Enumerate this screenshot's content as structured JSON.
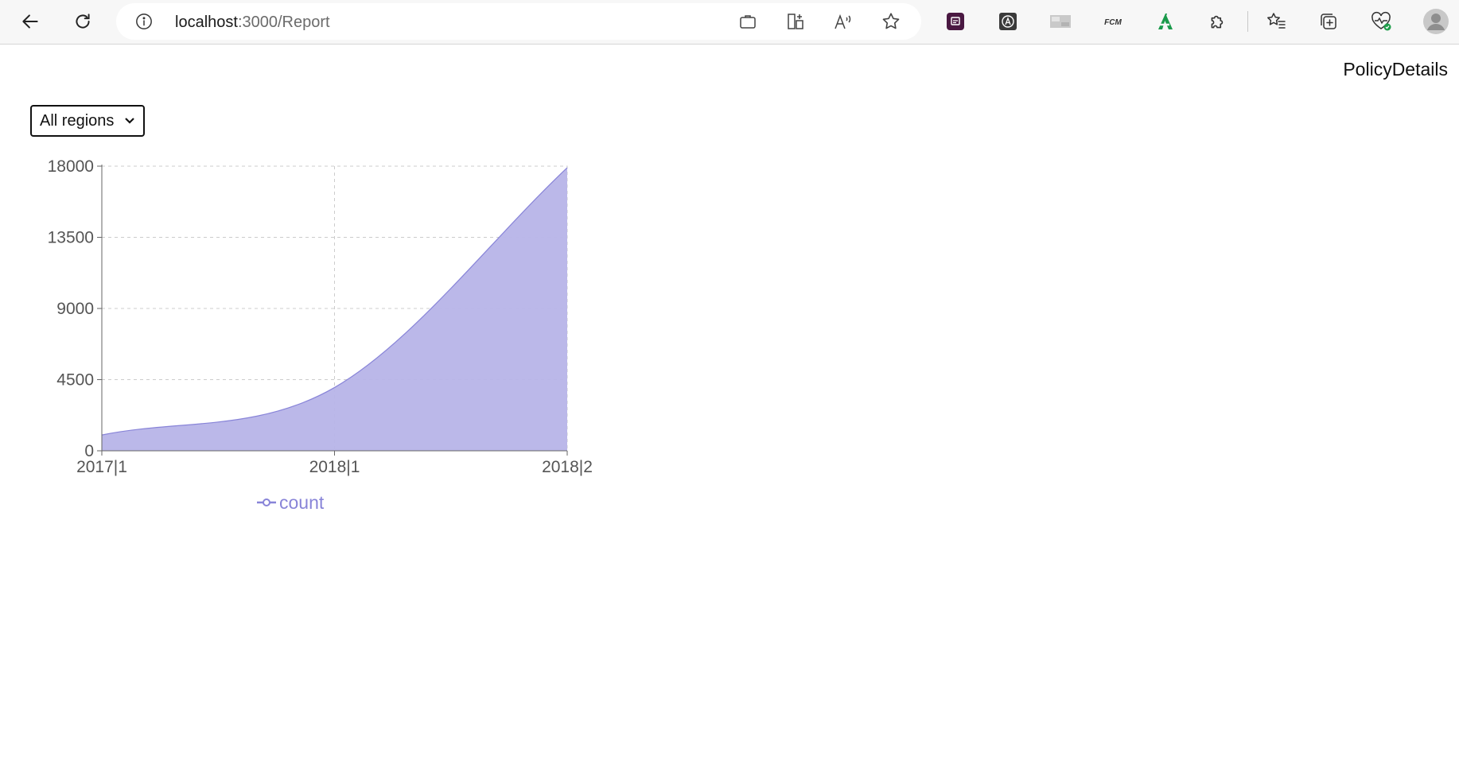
{
  "browser": {
    "url_host": "localhost",
    "url_rest": ":3000/Report",
    "icons": {
      "back": "back-arrow-icon",
      "reload": "reload-icon",
      "info": "site-info-icon",
      "app": "app-available-icon",
      "split": "split-screen-icon",
      "read_aloud": "read-aloud-icon",
      "favorite": "favorite-star-icon",
      "extensions": [
        "extension-1-icon",
        "extension-2-icon",
        "extension-3-icon",
        "extension-fcm-icon",
        "extension-a-icon"
      ],
      "puzzle": "extensions-puzzle-icon",
      "favorites": "favorites-icon",
      "collections": "collections-icon",
      "health": "browser-essentials-icon",
      "profile": "profile-avatar-icon"
    },
    "ext_fcm_text": "FCM"
  },
  "page": {
    "policy_link": "PolicyDetails",
    "region_select": {
      "selected": "All regions"
    }
  },
  "colors": {
    "series": "#8884d8",
    "area_fill": "#b7b4e8",
    "axis_text": "#555555",
    "grid": "#cccccc"
  },
  "chart_data": {
    "type": "area",
    "categories": [
      "2017|1",
      "2018|1",
      "2018|2"
    ],
    "series": [
      {
        "name": "count",
        "values": [
          1000,
          4000,
          17900
        ]
      }
    ],
    "y_ticks": [
      0,
      4500,
      9000,
      13500,
      18000
    ],
    "ylim": [
      0,
      18000
    ],
    "grid": true,
    "grid_style": "dashed",
    "legend": "bottom"
  }
}
